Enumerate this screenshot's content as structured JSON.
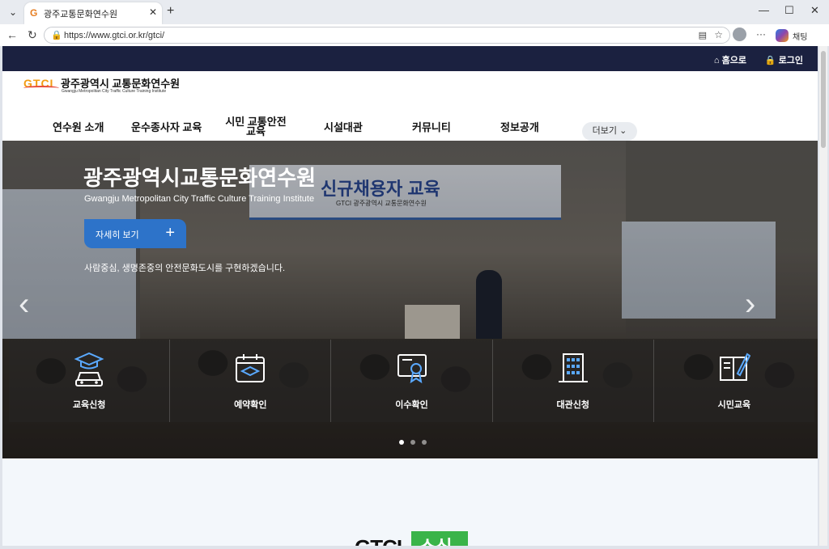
{
  "browser": {
    "tab_title": "광주교통문화연수원",
    "url": "https://www.gtci.or.kr/gtci/",
    "chat_label": "채팅"
  },
  "site": {
    "top_links": {
      "home": "홈으로",
      "login": "로그인"
    },
    "logo": {
      "mark": "GTCI",
      "title": "광주광역시 교통문화연수원",
      "subtitle": "Gwangju Metropolitan City Traffic Culture Training Institute"
    },
    "nav": [
      {
        "label": "연수원 소개"
      },
      {
        "label": "운수종사자 교육"
      },
      {
        "label": "시민 교통안전 교육"
      },
      {
        "label": "시설대관"
      },
      {
        "label": "커뮤니티"
      },
      {
        "label": "정보공개"
      }
    ],
    "more_label": "더보기"
  },
  "hero": {
    "title": "광주광역시교통문화연수원",
    "subtitle": "Gwangju Metropolitan City Traffic Culture Training Institute",
    "detail_button": "자세히 보기",
    "slogan": "사람중심, 생명존중의 안전문화도시를 구현하겠습니다.",
    "photo_banner_text": "신규채용자 교육",
    "photo_banner_sub": "GTCI 광주광역시 교통문화연수원",
    "slide_count": 3,
    "active_slide": 1
  },
  "quick_menu": [
    {
      "label": "교육신청",
      "icon": "car-graduation-icon"
    },
    {
      "label": "예약확인",
      "icon": "calendar-icon"
    },
    {
      "label": "이수확인",
      "icon": "certificate-icon"
    },
    {
      "label": "대관신청",
      "icon": "building-icon"
    },
    {
      "label": "시민교육",
      "icon": "book-pen-icon"
    }
  ],
  "section": {
    "title_left": "GTCI",
    "title_right": "소식"
  },
  "colors": {
    "top_strip": "#1b2140",
    "accent_blue": "#2d73c9",
    "news_green": "#3ab449"
  }
}
